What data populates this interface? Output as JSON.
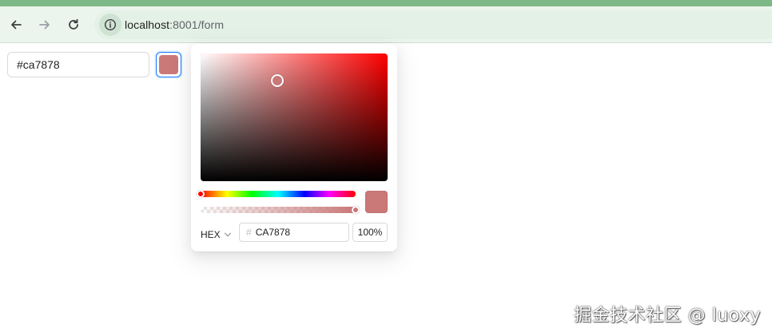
{
  "browser": {
    "url_host": "localhost",
    "url_rest": ":8001/form"
  },
  "form": {
    "hex_input_value": "#ca7878"
  },
  "picker": {
    "hue_color": "#ff0000",
    "selected_color": "#ca7878",
    "saturation_value": {
      "saturation": 0.41,
      "brightness": 0.79
    },
    "hue_position": 0,
    "alpha_position": 1,
    "format_label": "HEX",
    "hash_symbol": "#",
    "hex_value": "CA7878",
    "alpha_percent": "100%"
  },
  "watermark": {
    "text": "掘金技术社区 @ luoxy"
  },
  "colors": {
    "accent": "#1677ff",
    "chrome_green": "#7fb887",
    "toolbar_bg": "#ecf5ed"
  }
}
